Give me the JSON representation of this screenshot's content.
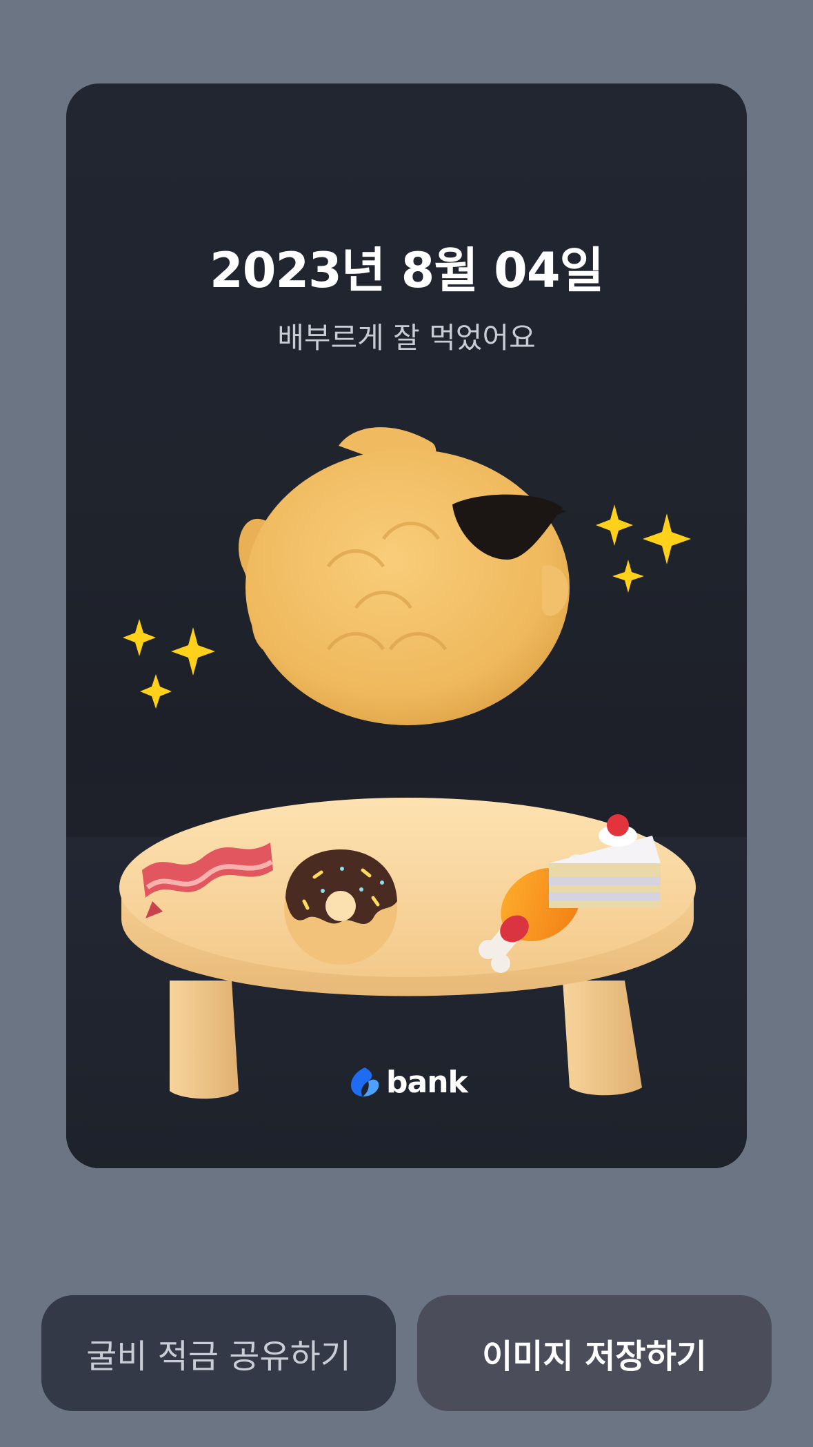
{
  "card": {
    "date": "2023년 8월 04일",
    "subtitle": "배부르게 잘 먹었어요",
    "logo_text": "bank",
    "illustration": {
      "main": "fish-bread-with-sunglasses",
      "table_items": [
        "bacon",
        "donut",
        "meat-on-bone",
        "cake-slice"
      ],
      "decorations": [
        "sparkle-icons"
      ]
    }
  },
  "buttons": {
    "share_label": "굴비 적금 공유하기",
    "save_label": "이미지 저장하기"
  },
  "colors": {
    "page_bg": "#6b7584",
    "card_bg": "#1f232c",
    "share_button_bg": "#333947",
    "save_button_bg": "#4b4d5a",
    "sparkle": "#ffd11a",
    "logo_blue": "#1d6cf2"
  }
}
